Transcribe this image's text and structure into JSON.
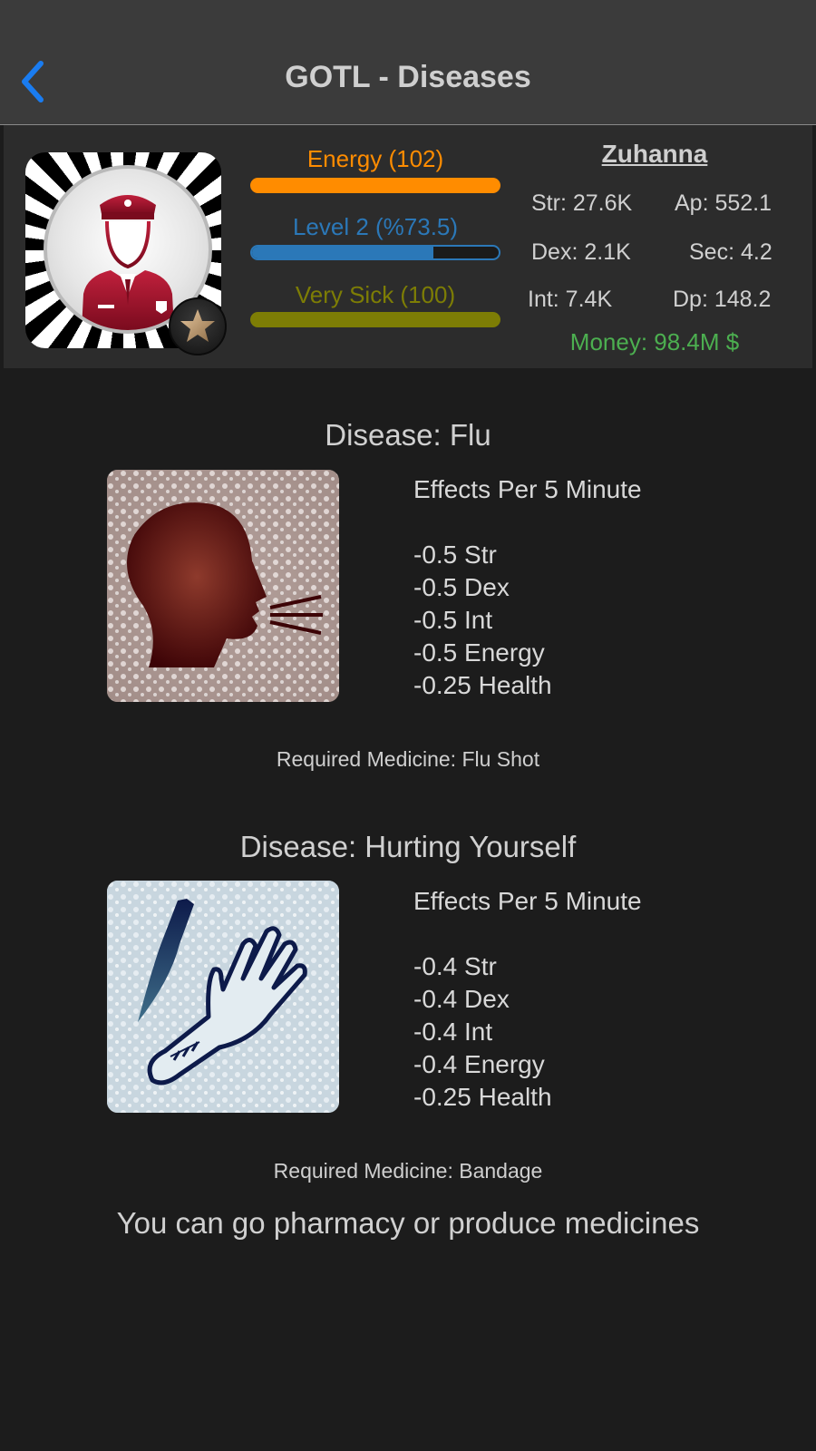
{
  "nav": {
    "title": "GOTL - Diseases",
    "back_icon": "chevron-left-icon"
  },
  "profile": {
    "name": "Zuhanna",
    "avatar_icon": "officer-avatar-icon",
    "badge_icon": "star-badge-icon",
    "energy": {
      "label": "Energy (102)",
      "fill_pct": 100,
      "color": "#ff8c00"
    },
    "level": {
      "label": "Level 2 (%73.5)",
      "fill_pct": 73.5,
      "color": "#2b78b8"
    },
    "sickness": {
      "label": "Very Sick (100)",
      "fill_pct": 100,
      "color": "#7d7d05"
    },
    "stats": {
      "str": "Str: 27.6K",
      "ap": "Ap: 552.1",
      "dex": "Dex: 2.1K",
      "sec": "Sec: 4.2",
      "int": "Int: 7.4K",
      "dp": "Dp: 148.2"
    },
    "money": "Money: 98.4M $"
  },
  "diseases": [
    {
      "title": "Disease: Flu",
      "icon": "sneezing-head-icon",
      "effects_header": "Effects Per 5 Minute",
      "effects": [
        "-0.5 Str",
        "-0.5 Dex",
        "-0.5 Int",
        "-0.5 Energy",
        "-0.25 Health"
      ],
      "medicine": "Required Medicine: Flu Shot"
    },
    {
      "title": "Disease: Hurting Yourself",
      "icon": "knife-hand-icon",
      "effects_header": "Effects Per 5 Minute",
      "effects": [
        "-0.4 Str",
        "-0.4 Dex",
        "-0.4 Int",
        "-0.4 Energy",
        "-0.25 Health"
      ],
      "medicine": "Required Medicine: Bandage"
    }
  ],
  "footer": "You can go pharmacy or produce medicines"
}
